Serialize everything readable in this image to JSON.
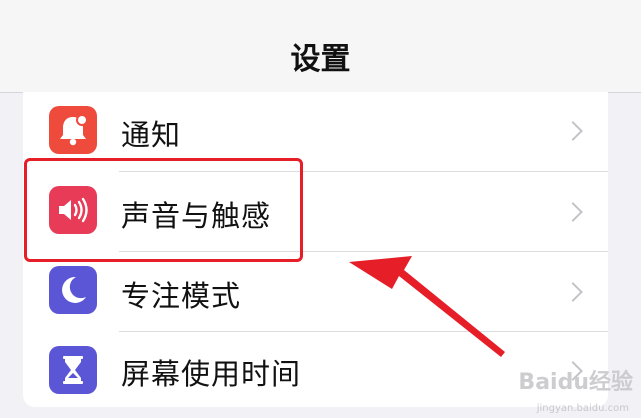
{
  "header": {
    "title": "设置"
  },
  "settings": {
    "items": [
      {
        "label": "通知",
        "icon": "bell-icon",
        "color": "#ee4b3c"
      },
      {
        "label": "声音与触感",
        "icon": "speaker-icon",
        "color": "#e83b57"
      },
      {
        "label": "专注模式",
        "icon": "moon-icon",
        "color": "#5b56d6"
      },
      {
        "label": "屏幕使用时间",
        "icon": "hourglass-icon",
        "color": "#5b56d6"
      }
    ]
  },
  "annotation": {
    "highlight_color": "#e61e28"
  },
  "watermark": {
    "text": "Baidu经验",
    "sub": "jingyan.baidu.com"
  }
}
